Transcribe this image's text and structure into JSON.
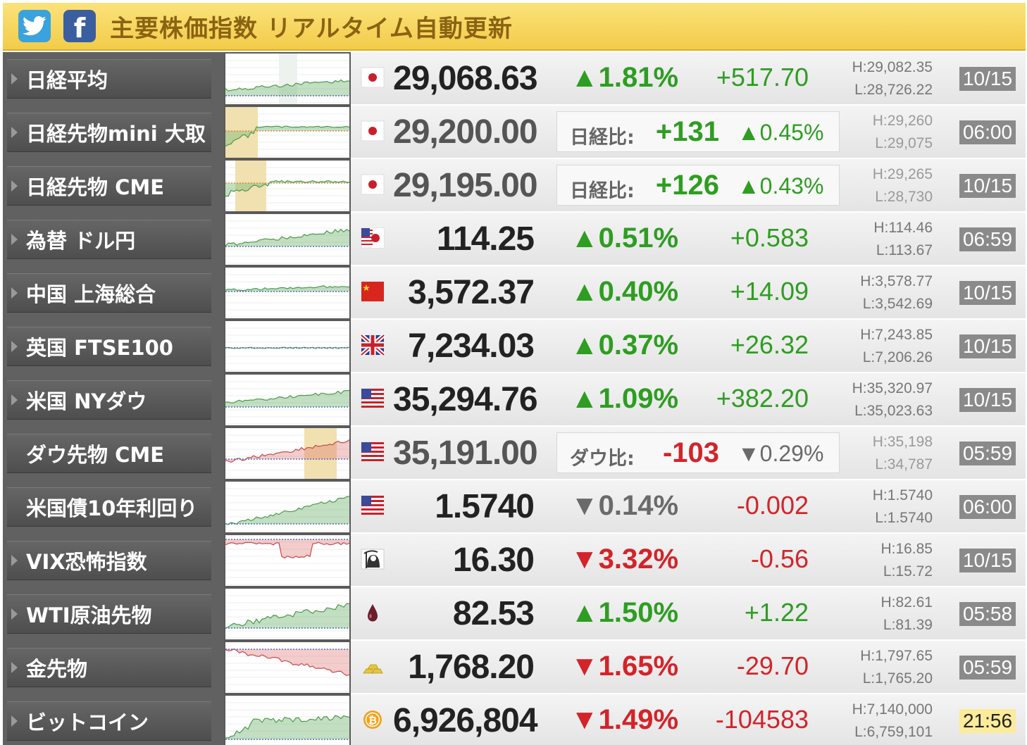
{
  "header": {
    "title": "主要株価指数 リアルタイム自動更新",
    "twitter_icon": "twitter-bird-icon",
    "facebook_icon": "facebook-f-icon",
    "facebook_letter": "f"
  },
  "colors": {
    "up": "#2e9d22",
    "down": "#d2242a",
    "header": "#f2cc4a",
    "title": "#8a6312"
  },
  "rows": [
    {
      "name": "日経平均",
      "arrow": true,
      "flag": "japan-flag-icon",
      "price": "29,068.63",
      "pct": "▲1.81%",
      "chg": "+517.70",
      "high": "H:29,082.35",
      "low": "L:28,726.22",
      "time": "10/15",
      "dir": "up"
    },
    {
      "name": "日経先物mini 大取",
      "arrow": true,
      "flag": "japan-flag-icon",
      "price": "29,200.00",
      "ref_label": "日経比:",
      "ref_diff": "+131",
      "ref_pct": "▲0.45%",
      "high": "H:29,260",
      "low": "L:29,075",
      "time": "06:00",
      "dir": "up"
    },
    {
      "name": "日経先物 CME",
      "arrow": true,
      "flag": "japan-flag-icon",
      "price": "29,195.00",
      "ref_label": "日経比:",
      "ref_diff": "+126",
      "ref_pct": "▲0.43%",
      "high": "H:29,265",
      "low": "L:28,730",
      "time": "10/15",
      "dir": "up"
    },
    {
      "name": "為替 ドル円",
      "arrow": true,
      "flag": "usd-jpy-flag-icon",
      "price": "114.25",
      "pct": "▲0.51%",
      "chg": "+0.583",
      "high": "H:114.46",
      "low": "L:113.67",
      "time": "06:59",
      "dir": "up"
    },
    {
      "name": "中国 上海総合",
      "arrow": true,
      "flag": "china-flag-icon",
      "price": "3,572.37",
      "pct": "▲0.40%",
      "chg": "+14.09",
      "high": "H:3,578.77",
      "low": "L:3,542.69",
      "time": "10/15",
      "dir": "up"
    },
    {
      "name": "英国 FTSE100",
      "arrow": true,
      "flag": "uk-flag-icon",
      "price": "7,234.03",
      "pct": "▲0.37%",
      "chg": "+26.32",
      "high": "H:7,243.85",
      "low": "L:7,206.26",
      "time": "10/15",
      "dir": "up"
    },
    {
      "name": "米国 NYダウ",
      "arrow": true,
      "flag": "us-flag-icon",
      "price": "35,294.76",
      "pct": "▲1.09%",
      "chg": "+382.20",
      "high": "H:35,320.97",
      "low": "L:35,023.63",
      "time": "10/15",
      "dir": "up"
    },
    {
      "name": "ダウ先物 CME",
      "arrow": false,
      "flag": "us-flag-icon",
      "price": "35,191.00",
      "ref_label": "ダウ比:",
      "ref_diff": "-103",
      "ref_pct": "▼0.29%",
      "high": "H:35,198",
      "low": "L:34,787",
      "time": "05:59",
      "dir": "down"
    },
    {
      "name": "米国債10年利回り",
      "arrow": false,
      "flag": "us-flag-icon",
      "price": "1.5740",
      "pct": "▼0.14%",
      "chg": "-0.002",
      "high": "H:1.5740",
      "low": "L:1.5740",
      "time": "06:00",
      "dir": "down-grey"
    },
    {
      "name": "VIX恐怖指数",
      "arrow": true,
      "flag": "reaper-icon",
      "price": "16.30",
      "pct": "▼3.32%",
      "chg": "-0.56",
      "high": "H:16.85",
      "low": "L:15.72",
      "time": "10/15",
      "dir": "down"
    },
    {
      "name": "WTI原油先物",
      "arrow": true,
      "flag": "oil-drop-icon",
      "price": "82.53",
      "pct": "▲1.50%",
      "chg": "+1.22",
      "high": "H:82.61",
      "low": "L:81.39",
      "time": "05:58",
      "dir": "up"
    },
    {
      "name": "金先物",
      "arrow": true,
      "flag": "gold-bars-icon",
      "price": "1,768.20",
      "pct": "▼1.65%",
      "chg": "-29.70",
      "high": "H:1,797.65",
      "low": "L:1,765.20",
      "time": "05:59",
      "dir": "down"
    },
    {
      "name": "ビットコイン",
      "arrow": true,
      "flag": "bitcoin-icon",
      "price": "6,926,804",
      "pct": "▼1.49%",
      "chg": "-104583",
      "high": "H:7,140,000",
      "low": "L:6,759,101",
      "time": "21:56",
      "dir": "down",
      "time_highlight": true
    }
  ]
}
